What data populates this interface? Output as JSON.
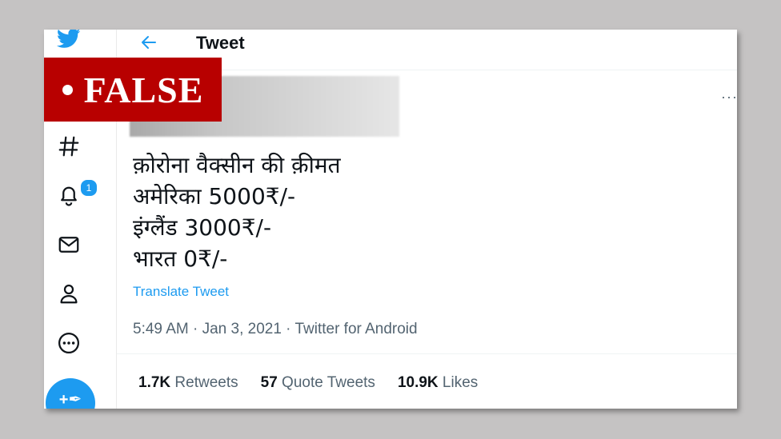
{
  "colors": {
    "twitter_blue": "#1d9bf0",
    "false_red": "#b80000",
    "text_primary": "#0f1419",
    "text_secondary": "#536471"
  },
  "sidebar": {
    "icons": [
      "twitter-logo-icon",
      "hashtag-icon",
      "bell-icon",
      "mail-icon",
      "profile-icon",
      "more-circle-icon"
    ],
    "notification_count": "1",
    "fab_icon": "compose-tweet-icon"
  },
  "header": {
    "title": "Tweet",
    "back_icon": "arrow-left-icon"
  },
  "tweet": {
    "lines": [
      "क़ोरोना वैक्सीन की क़ीमत",
      "अमेरिका 5000₹/-",
      "इंग्लैंड 3000₹/-",
      "भारत 0₹/-"
    ],
    "translate_label": "Translate Tweet",
    "timestamp": "5:49 AM · Jan 3, 2021 · Twitter for Android",
    "more_label": "···"
  },
  "stats": {
    "retweets_count": "1.7K",
    "retweets_label": "Retweets",
    "quotes_count": "57",
    "quotes_label": "Quote Tweets",
    "likes_count": "10.9K",
    "likes_label": "Likes"
  },
  "overlay": {
    "label": "FALSE"
  }
}
